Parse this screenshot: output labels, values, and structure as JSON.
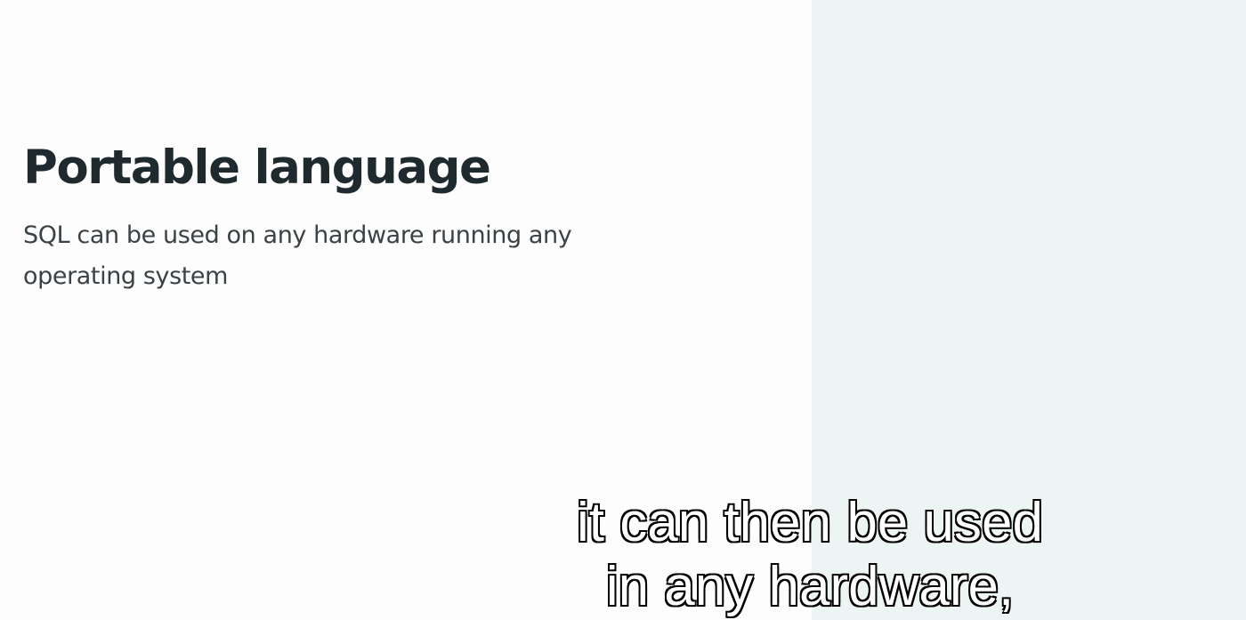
{
  "slide": {
    "title": "Portable language",
    "body_lines": [
      "SQL can be used on any hardware running any",
      "operating system"
    ],
    "colors": {
      "background": "#fdfdfd",
      "side_panel": "#edf5f4",
      "title": "#1f2a2e",
      "body": "#3b4245"
    }
  },
  "caption": {
    "lines": [
      "it can then be used",
      "in any hardware,"
    ],
    "colors": {
      "fill": "#ffffff",
      "outline": "#000000"
    }
  }
}
